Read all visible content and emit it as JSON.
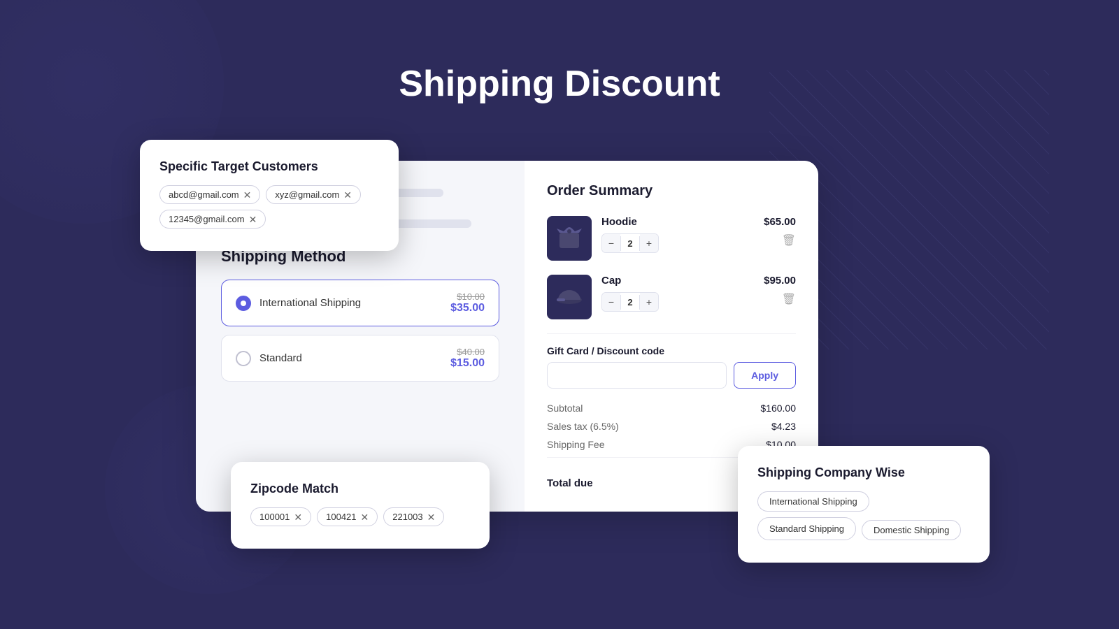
{
  "page": {
    "title": "Shipping Discount",
    "background_color": "#2d2b5b"
  },
  "target_customers_card": {
    "title": "Specific Target Customers",
    "emails": [
      {
        "value": "abcd@gmail.com"
      },
      {
        "value": "xyz@gmail.com"
      },
      {
        "value": "12345@gmail.com"
      }
    ]
  },
  "shipping_method": {
    "title": "Shipping Method",
    "options": [
      {
        "name": "International Shipping",
        "original_price": "$10.00",
        "discounted_price": "$35.00",
        "selected": true
      },
      {
        "name": "Standard",
        "original_price": "$40.00",
        "discounted_price": "$15.00",
        "selected": false
      }
    ]
  },
  "order_summary": {
    "title": "Order Summary",
    "items": [
      {
        "name": "Hoodie",
        "price": "$65.00",
        "quantity": 2,
        "icon_type": "hoodie"
      },
      {
        "name": "Cap",
        "price": "$95.00",
        "quantity": 2,
        "icon_type": "cap"
      }
    ],
    "gift_card_label": "Gift Card / Discount code",
    "gift_card_placeholder": "",
    "apply_button": "Apply",
    "subtotal_label": "Subtotal",
    "subtotal_value": "$160.00",
    "tax_label": "Sales tax (6.5%)",
    "tax_value": "$4.23",
    "shipping_fee_label": "Shipping Fee",
    "shipping_fee_value": "$10.00",
    "total_label": "Total due",
    "total_value": ""
  },
  "zipcode_card": {
    "title": "Zipcode Match",
    "zipcodes": [
      {
        "value": "100001"
      },
      {
        "value": "100421"
      },
      {
        "value": "221003"
      }
    ]
  },
  "shipping_company_card": {
    "title": "Shipping Company Wise",
    "tags": [
      {
        "label": "International Shipping"
      },
      {
        "label": "Standard Shipping"
      },
      {
        "label": "Domestic Shipping"
      }
    ]
  }
}
